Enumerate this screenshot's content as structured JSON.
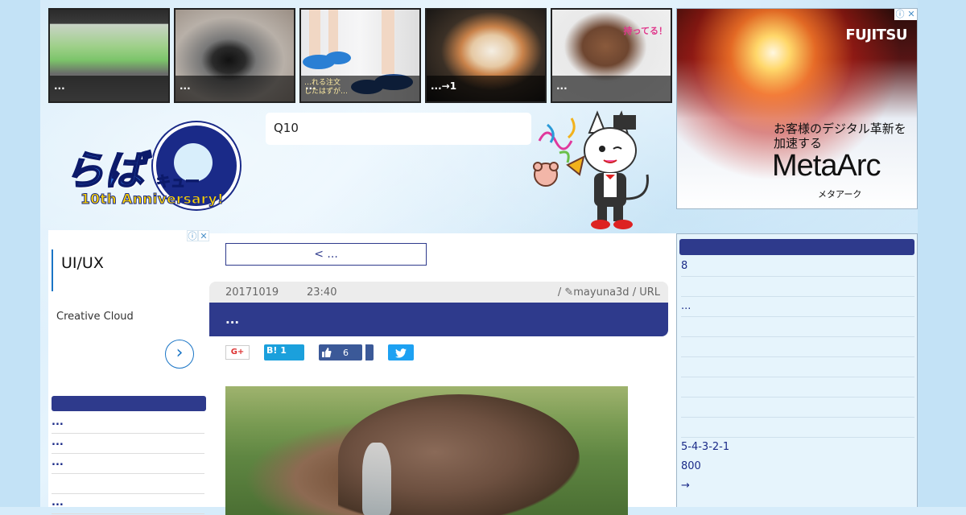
{
  "thumbnails": [
    {
      "caption": "..."
    },
    {
      "caption": "..."
    },
    {
      "caption": "...",
      "overlay_text": "…れる注文\nしたはずが…"
    },
    {
      "caption": "...→1"
    },
    {
      "caption": "...",
      "overlay_text": "持ってる！"
    }
  ],
  "ad_right": {
    "brand": "FUJITSU",
    "line1": "お客様のデジタル革新を",
    "line2": "加速する",
    "product": "MetaArc",
    "product_kana": "メタアーク",
    "info_icon": "ⓘ",
    "close_icon": "✕"
  },
  "logo": {
    "main": "らば",
    "kyu": "キュー",
    "anniversary": "10th Anniversary!"
  },
  "search": {
    "value": "Q10"
  },
  "ad_left": {
    "title": "UI/UX",
    "text": "Creative Cloud",
    "arrow": "›",
    "info_icon": "ⓘ",
    "close_icon": "✕"
  },
  "left_list": [
    "...",
    "...",
    "...",
    "",
    "..."
  ],
  "article": {
    "prev_label": "< ...",
    "date": "20171019",
    "time": "23:40",
    "author": "/ ✎mayuna3d / URL",
    "title": "...",
    "share": {
      "gplus": "G+",
      "hatena": "B! 1",
      "fb_count": "6",
      "twitter": "twitter"
    }
  },
  "right_list": [
    "8",
    "",
    "...",
    "",
    "",
    "",
    "",
    "",
    "",
    "5-4-3-2-1",
    "800",
    "→"
  ],
  "colors": {
    "accent_navy": "#2e3a8c",
    "hatena_blue": "#1ba0dc",
    "facebook_blue": "#3b5998",
    "twitter_blue": "#1da1f2"
  }
}
